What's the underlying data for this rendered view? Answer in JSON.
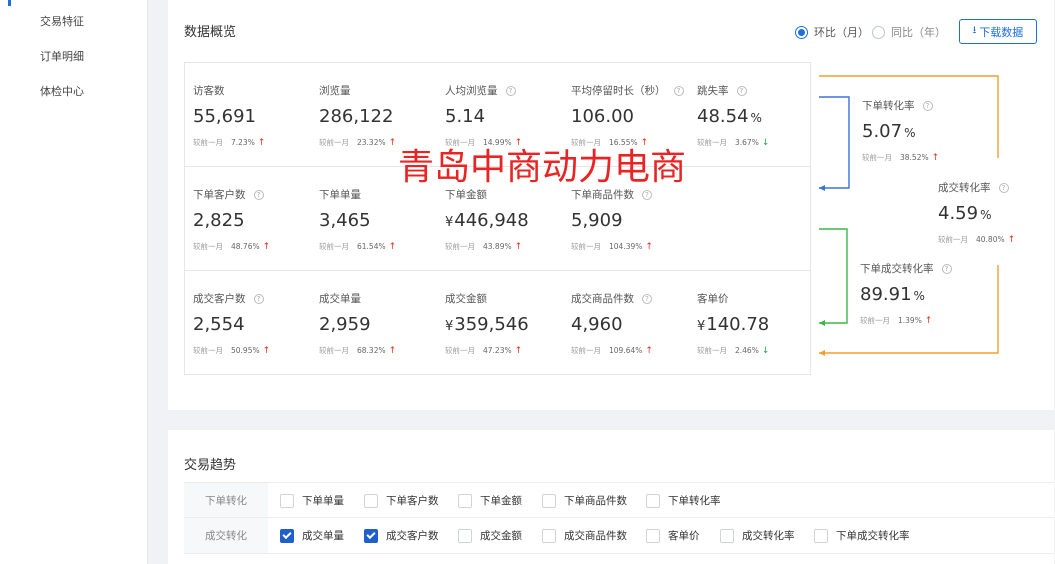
{
  "sidebar": {
    "items": [
      {
        "label": "交易特征"
      },
      {
        "label": "订单明细"
      },
      {
        "label": "体检中心"
      }
    ]
  },
  "overview": {
    "title": "数据概览",
    "radio_mom": "环比（月）",
    "radio_yoy": "同比（年）",
    "download_label": "下载数据",
    "compare_text": "较前一月",
    "rows": [
      [
        {
          "label": "访客数",
          "value": "55,691",
          "pct": "7.23%",
          "trend": "up",
          "help": false
        },
        {
          "label": "浏览量",
          "value": "286,122",
          "pct": "23.32%",
          "trend": "up",
          "help": false
        },
        {
          "label": "人均浏览量",
          "value": "5.14",
          "pct": "14.99%",
          "trend": "up",
          "help": true
        },
        {
          "label": "平均停留时长（秒）",
          "value": "106.00",
          "pct": "16.55%",
          "trend": "up",
          "help": true
        },
        {
          "label": "跳失率",
          "value": "48.54",
          "unit": "%",
          "pct": "3.67%",
          "trend": "down",
          "help": true
        }
      ],
      [
        {
          "label": "下单客户数",
          "value": "2,825",
          "pct": "48.76%",
          "trend": "up",
          "help": true
        },
        {
          "label": "下单单量",
          "value": "3,465",
          "pct": "61.54%",
          "trend": "up",
          "help": false
        },
        {
          "label": "下单金额",
          "currency": "¥",
          "value": "446,948",
          "pct": "43.89%",
          "trend": "up",
          "help": false
        },
        {
          "label": "下单商品件数",
          "value": "5,909",
          "pct": "104.39%",
          "trend": "up",
          "help": true
        }
      ],
      [
        {
          "label": "成交客户数",
          "value": "2,554",
          "pct": "50.95%",
          "trend": "up",
          "help": true
        },
        {
          "label": "成交单量",
          "value": "2,959",
          "pct": "68.32%",
          "trend": "up",
          "help": false
        },
        {
          "label": "成交金额",
          "currency": "¥",
          "value": "359,546",
          "pct": "47.23%",
          "trend": "up",
          "help": false
        },
        {
          "label": "成交商品件数",
          "value": "4,960",
          "pct": "109.64%",
          "trend": "up",
          "help": true
        },
        {
          "label": "客单价",
          "currency": "¥",
          "value": "140.78",
          "pct": "2.46%",
          "trend": "down",
          "help": false
        }
      ]
    ],
    "conversions": [
      {
        "label": "下单转化率",
        "value": "5.07",
        "unit": "%",
        "pct": "38.52%",
        "trend": "up"
      },
      {
        "label": "成交转化率",
        "value": "4.59",
        "unit": "%",
        "pct": "40.80%",
        "trend": "up"
      },
      {
        "label": "下单成交转化率",
        "value": "89.91",
        "unit": "%",
        "pct": "1.39%",
        "trend": "up"
      }
    ],
    "flow_colors": {
      "blue": "#3a73d6",
      "orange": "#f0a030",
      "green": "#3cb84a"
    }
  },
  "watermark": "青岛中商动力电商",
  "trend": {
    "title": "交易趋势",
    "rows": [
      {
        "label": "下单转化",
        "options": [
          {
            "label": "下单单量",
            "checked": false
          },
          {
            "label": "下单客户数",
            "checked": false
          },
          {
            "label": "下单金额",
            "checked": false
          },
          {
            "label": "下单商品件数",
            "checked": false
          },
          {
            "label": "下单转化率",
            "checked": false
          }
        ]
      },
      {
        "label": "成交转化",
        "options": [
          {
            "label": "成交单量",
            "checked": true
          },
          {
            "label": "成交客户数",
            "checked": true
          },
          {
            "label": "成交金额",
            "checked": false
          },
          {
            "label": "成交商品件数",
            "checked": false
          },
          {
            "label": "客单价",
            "checked": false
          },
          {
            "label": "成交转化率",
            "checked": false
          },
          {
            "label": "下单成交转化率",
            "checked": false
          }
        ]
      }
    ]
  }
}
